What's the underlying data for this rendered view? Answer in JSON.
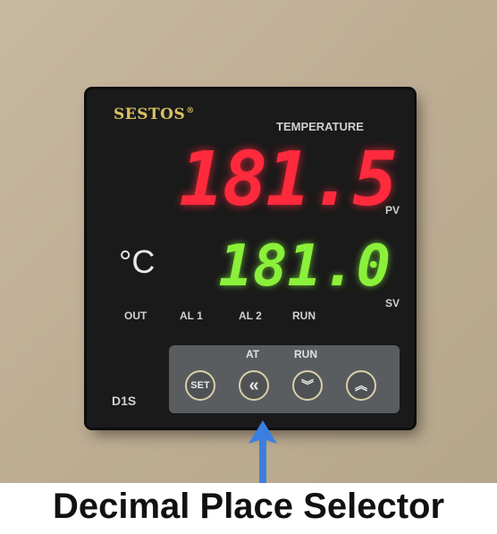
{
  "device": {
    "brand": "SESTOS",
    "brand_mark": "®",
    "measurement_label": "TEMPERATURE",
    "pv": {
      "value": "181.5",
      "label": "PV",
      "color": "#ff2a3c"
    },
    "sv": {
      "value": "181.0",
      "label": "SV",
      "color": "#8af03a"
    },
    "unit": "°C",
    "indicators": [
      "OUT",
      "AL 1",
      "AL 2",
      "RUN"
    ],
    "model": "D1S",
    "keypad": {
      "labels": {
        "at": "AT",
        "run": "RUN"
      },
      "set_key": "SET",
      "shift_key": "«",
      "down_key": "︾",
      "up_key": "︽",
      "border_color": "#d8d0a8"
    }
  },
  "annotation": {
    "caption": "Decimal Place Selector",
    "arrow_color": "#3a7fe0",
    "points_to": "shift-key"
  }
}
